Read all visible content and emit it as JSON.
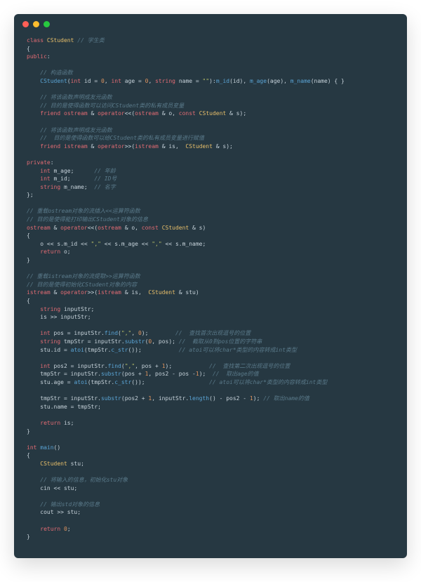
{
  "traffic": {
    "red": "#ff5f56",
    "yellow": "#ffbd2e",
    "green": "#27c93f"
  },
  "code": {
    "tokens": [
      [
        {
          "t": "class ",
          "c": "kw"
        },
        {
          "t": "CStudent",
          "c": "cl"
        },
        {
          "t": " ",
          "c": "op"
        },
        {
          "t": "// 学生类",
          "c": "cm"
        }
      ],
      [
        {
          "t": "{",
          "c": "pn"
        }
      ],
      [
        {
          "t": "public",
          "c": "kw"
        },
        {
          "t": ":",
          "c": "pn"
        }
      ],
      [
        {
          "t": "",
          "c": "op"
        }
      ],
      [
        {
          "t": "    ",
          "c": "op"
        },
        {
          "t": "// 构造函数",
          "c": "cm"
        }
      ],
      [
        {
          "t": "    ",
          "c": "op"
        },
        {
          "t": "CStudent",
          "c": "fn"
        },
        {
          "t": "(",
          "c": "pn"
        },
        {
          "t": "int",
          "c": "ty"
        },
        {
          "t": " id = ",
          "c": "op"
        },
        {
          "t": "0",
          "c": "nb"
        },
        {
          "t": ", ",
          "c": "op"
        },
        {
          "t": "int",
          "c": "ty"
        },
        {
          "t": " age = ",
          "c": "op"
        },
        {
          "t": "0",
          "c": "nb"
        },
        {
          "t": ", ",
          "c": "op"
        },
        {
          "t": "string",
          "c": "ty"
        },
        {
          "t": " name = ",
          "c": "op"
        },
        {
          "t": "\"\"",
          "c": "st"
        },
        {
          "t": "):",
          "c": "pn"
        },
        {
          "t": "m_id",
          "c": "fn"
        },
        {
          "t": "(id), ",
          "c": "op"
        },
        {
          "t": "m_age",
          "c": "fn"
        },
        {
          "t": "(age), ",
          "c": "op"
        },
        {
          "t": "m_name",
          "c": "fn"
        },
        {
          "t": "(name) { }",
          "c": "pn"
        }
      ],
      [
        {
          "t": "",
          "c": "op"
        }
      ],
      [
        {
          "t": "    ",
          "c": "op"
        },
        {
          "t": "// 将该函数声明成友元函数",
          "c": "cm"
        }
      ],
      [
        {
          "t": "    ",
          "c": "op"
        },
        {
          "t": "// 目的是使得函数可以访问CStudent类的私有成员变量",
          "c": "cm"
        }
      ],
      [
        {
          "t": "    ",
          "c": "op"
        },
        {
          "t": "friend",
          "c": "kw"
        },
        {
          "t": " ",
          "c": "op"
        },
        {
          "t": "ostream",
          "c": "ty"
        },
        {
          "t": " & ",
          "c": "op"
        },
        {
          "t": "operator",
          "c": "kw"
        },
        {
          "t": "<<(",
          "c": "pn"
        },
        {
          "t": "ostream",
          "c": "ty"
        },
        {
          "t": " & o, ",
          "c": "op"
        },
        {
          "t": "const",
          "c": "kw"
        },
        {
          "t": " ",
          "c": "op"
        },
        {
          "t": "CStudent",
          "c": "cl"
        },
        {
          "t": " & s);",
          "c": "pn"
        }
      ],
      [
        {
          "t": "",
          "c": "op"
        }
      ],
      [
        {
          "t": "    ",
          "c": "op"
        },
        {
          "t": "// 将该函数声明成友元函数",
          "c": "cm"
        }
      ],
      [
        {
          "t": "    ",
          "c": "op"
        },
        {
          "t": "//  目的是使得函数可以给CStudent类的私有成员变量进行赋值",
          "c": "cm"
        }
      ],
      [
        {
          "t": "    ",
          "c": "op"
        },
        {
          "t": "friend",
          "c": "kw"
        },
        {
          "t": " ",
          "c": "op"
        },
        {
          "t": "istream",
          "c": "ty"
        },
        {
          "t": " & ",
          "c": "op"
        },
        {
          "t": "operator",
          "c": "kw"
        },
        {
          "t": ">>(",
          "c": "pn"
        },
        {
          "t": "istream",
          "c": "ty"
        },
        {
          "t": " & is,  ",
          "c": "op"
        },
        {
          "t": "CStudent",
          "c": "cl"
        },
        {
          "t": " & s);",
          "c": "pn"
        }
      ],
      [
        {
          "t": "",
          "c": "op"
        }
      ],
      [
        {
          "t": "private",
          "c": "kw"
        },
        {
          "t": ":",
          "c": "pn"
        }
      ],
      [
        {
          "t": "    ",
          "c": "op"
        },
        {
          "t": "int",
          "c": "ty"
        },
        {
          "t": " m_age;      ",
          "c": "id"
        },
        {
          "t": "// 年龄",
          "c": "cm"
        }
      ],
      [
        {
          "t": "    ",
          "c": "op"
        },
        {
          "t": "int",
          "c": "ty"
        },
        {
          "t": " m_id;       ",
          "c": "id"
        },
        {
          "t": "// ID号",
          "c": "cm"
        }
      ],
      [
        {
          "t": "    ",
          "c": "op"
        },
        {
          "t": "string",
          "c": "ty"
        },
        {
          "t": " m_name;  ",
          "c": "id"
        },
        {
          "t": "// 名字",
          "c": "cm"
        }
      ],
      [
        {
          "t": "};",
          "c": "pn"
        }
      ],
      [
        {
          "t": "",
          "c": "op"
        }
      ],
      [
        {
          "t": "// 重载ostream对象的流插入<<运算符函数",
          "c": "cm"
        }
      ],
      [
        {
          "t": "// 目的是使得能打印输出CStudent对象的信息",
          "c": "cm"
        }
      ],
      [
        {
          "t": "ostream",
          "c": "ty"
        },
        {
          "t": " & ",
          "c": "op"
        },
        {
          "t": "operator",
          "c": "kw"
        },
        {
          "t": "<<(",
          "c": "pn"
        },
        {
          "t": "ostream",
          "c": "ty"
        },
        {
          "t": " & o, ",
          "c": "op"
        },
        {
          "t": "const",
          "c": "kw"
        },
        {
          "t": " ",
          "c": "op"
        },
        {
          "t": "CStudent",
          "c": "cl"
        },
        {
          "t": " & s)",
          "c": "pn"
        }
      ],
      [
        {
          "t": "{",
          "c": "pn"
        }
      ],
      [
        {
          "t": "    o << s.m_id << ",
          "c": "id"
        },
        {
          "t": "\",\"",
          "c": "st"
        },
        {
          "t": " << s.m_age << ",
          "c": "id"
        },
        {
          "t": "\",\"",
          "c": "st"
        },
        {
          "t": " << s.m_name;",
          "c": "id"
        }
      ],
      [
        {
          "t": "    ",
          "c": "op"
        },
        {
          "t": "return",
          "c": "kw"
        },
        {
          "t": " o;",
          "c": "id"
        }
      ],
      [
        {
          "t": "}",
          "c": "pn"
        }
      ],
      [
        {
          "t": "",
          "c": "op"
        }
      ],
      [
        {
          "t": "// 重载istream对象的流提取>>运算符函数",
          "c": "cm"
        }
      ],
      [
        {
          "t": "// 目的是使得初始化CStudent对象的内容",
          "c": "cm"
        }
      ],
      [
        {
          "t": "istream",
          "c": "ty"
        },
        {
          "t": " & ",
          "c": "op"
        },
        {
          "t": "operator",
          "c": "kw"
        },
        {
          "t": ">>(",
          "c": "pn"
        },
        {
          "t": "istream",
          "c": "ty"
        },
        {
          "t": " & is,  ",
          "c": "op"
        },
        {
          "t": "CStudent",
          "c": "cl"
        },
        {
          "t": " & stu)",
          "c": "pn"
        }
      ],
      [
        {
          "t": "{",
          "c": "pn"
        }
      ],
      [
        {
          "t": "    ",
          "c": "op"
        },
        {
          "t": "string",
          "c": "ty"
        },
        {
          "t": " inputStr;",
          "c": "id"
        }
      ],
      [
        {
          "t": "    is >> inputStr;",
          "c": "id"
        }
      ],
      [
        {
          "t": "",
          "c": "op"
        }
      ],
      [
        {
          "t": "    ",
          "c": "op"
        },
        {
          "t": "int",
          "c": "ty"
        },
        {
          "t": " pos = inputStr.",
          "c": "id"
        },
        {
          "t": "find",
          "c": "fn"
        },
        {
          "t": "(",
          "c": "pn"
        },
        {
          "t": "\",\"",
          "c": "st"
        },
        {
          "t": ", ",
          "c": "op"
        },
        {
          "t": "0",
          "c": "nb"
        },
        {
          "t": ");        ",
          "c": "pn"
        },
        {
          "t": "//  查找首次出现逗号的位置",
          "c": "cm"
        }
      ],
      [
        {
          "t": "    ",
          "c": "op"
        },
        {
          "t": "string",
          "c": "ty"
        },
        {
          "t": " tmpStr = inputStr.",
          "c": "id"
        },
        {
          "t": "substr",
          "c": "fn"
        },
        {
          "t": "(",
          "c": "pn"
        },
        {
          "t": "0",
          "c": "nb"
        },
        {
          "t": ", pos); ",
          "c": "pn"
        },
        {
          "t": "//  截取从0到pos位置的字符串",
          "c": "cm"
        }
      ],
      [
        {
          "t": "    stu.id = ",
          "c": "id"
        },
        {
          "t": "atoi",
          "c": "fn"
        },
        {
          "t": "(tmpStr.",
          "c": "id"
        },
        {
          "t": "c_str",
          "c": "fn"
        },
        {
          "t": "());           ",
          "c": "pn"
        },
        {
          "t": "// atoi可以将char*类型的内容转成int类型",
          "c": "cm"
        }
      ],
      [
        {
          "t": "",
          "c": "op"
        }
      ],
      [
        {
          "t": "    ",
          "c": "op"
        },
        {
          "t": "int",
          "c": "ty"
        },
        {
          "t": " pos2 = inputStr.",
          "c": "id"
        },
        {
          "t": "find",
          "c": "fn"
        },
        {
          "t": "(",
          "c": "pn"
        },
        {
          "t": "\",\"",
          "c": "st"
        },
        {
          "t": ", pos + ",
          "c": "op"
        },
        {
          "t": "1",
          "c": "nb"
        },
        {
          "t": ");           ",
          "c": "pn"
        },
        {
          "t": "//  查找第二次出现逗号的位置",
          "c": "cm"
        }
      ],
      [
        {
          "t": "    tmpStr = inputStr.",
          "c": "id"
        },
        {
          "t": "substr",
          "c": "fn"
        },
        {
          "t": "(pos + ",
          "c": "op"
        },
        {
          "t": "1",
          "c": "nb"
        },
        {
          "t": ", pos2 - pos -",
          "c": "op"
        },
        {
          "t": "1",
          "c": "nb"
        },
        {
          "t": ");  ",
          "c": "pn"
        },
        {
          "t": "//  取出age的值",
          "c": "cm"
        }
      ],
      [
        {
          "t": "    stu.age = ",
          "c": "id"
        },
        {
          "t": "atoi",
          "c": "fn"
        },
        {
          "t": "(tmpStr.",
          "c": "id"
        },
        {
          "t": "c_str",
          "c": "fn"
        },
        {
          "t": "());                   ",
          "c": "pn"
        },
        {
          "t": "// atoi可以将char*类型的内容转成int类型",
          "c": "cm"
        }
      ],
      [
        {
          "t": "",
          "c": "op"
        }
      ],
      [
        {
          "t": "    tmpStr = inputStr.",
          "c": "id"
        },
        {
          "t": "substr",
          "c": "fn"
        },
        {
          "t": "(pos2 + ",
          "c": "op"
        },
        {
          "t": "1",
          "c": "nb"
        },
        {
          "t": ", inputStr.",
          "c": "id"
        },
        {
          "t": "length",
          "c": "fn"
        },
        {
          "t": "() - pos2 - ",
          "c": "op"
        },
        {
          "t": "1",
          "c": "nb"
        },
        {
          "t": "); ",
          "c": "pn"
        },
        {
          "t": "// 取出name的值",
          "c": "cm"
        }
      ],
      [
        {
          "t": "    stu.name = tmpStr;",
          "c": "id"
        }
      ],
      [
        {
          "t": "",
          "c": "op"
        }
      ],
      [
        {
          "t": "    ",
          "c": "op"
        },
        {
          "t": "return",
          "c": "kw"
        },
        {
          "t": " is;",
          "c": "id"
        }
      ],
      [
        {
          "t": "}",
          "c": "pn"
        }
      ],
      [
        {
          "t": "",
          "c": "op"
        }
      ],
      [
        {
          "t": "int",
          "c": "ty"
        },
        {
          "t": " ",
          "c": "op"
        },
        {
          "t": "main",
          "c": "fn"
        },
        {
          "t": "()",
          "c": "pn"
        }
      ],
      [
        {
          "t": "{",
          "c": "pn"
        }
      ],
      [
        {
          "t": "    ",
          "c": "op"
        },
        {
          "t": "CStudent",
          "c": "cl"
        },
        {
          "t": " stu;",
          "c": "id"
        }
      ],
      [
        {
          "t": "",
          "c": "op"
        }
      ],
      [
        {
          "t": "    ",
          "c": "op"
        },
        {
          "t": "// 将输入的信息，初始化stu对象",
          "c": "cm"
        }
      ],
      [
        {
          "t": "    cin << stu;",
          "c": "id"
        }
      ],
      [
        {
          "t": "",
          "c": "op"
        }
      ],
      [
        {
          "t": "    ",
          "c": "op"
        },
        {
          "t": "// 输出std对象的信息",
          "c": "cm"
        }
      ],
      [
        {
          "t": "    cout >> stu;",
          "c": "id"
        }
      ],
      [
        {
          "t": "",
          "c": "op"
        }
      ],
      [
        {
          "t": "    ",
          "c": "op"
        },
        {
          "t": "return",
          "c": "kw"
        },
        {
          "t": " ",
          "c": "op"
        },
        {
          "t": "0",
          "c": "nb"
        },
        {
          "t": ";",
          "c": "pn"
        }
      ],
      [
        {
          "t": "}",
          "c": "pn"
        }
      ]
    ]
  }
}
